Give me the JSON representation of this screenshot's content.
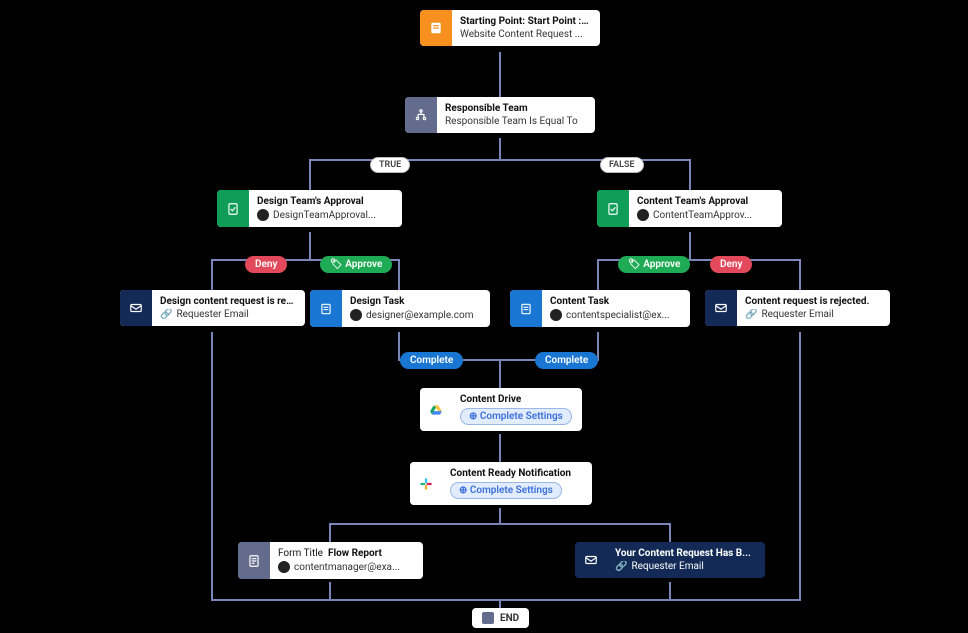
{
  "nodes": {
    "start": {
      "title": "Starting Point: Start Point : C...",
      "sub": "Website Content Request ..."
    },
    "decision": {
      "title": "Responsible Team",
      "sub": "Responsible Team Is Equal To"
    },
    "design_appr": {
      "title": "Design Team's Approval",
      "sub": "DesignTeamApproval..."
    },
    "content_appr": {
      "title": "Content Team's Approval",
      "sub": "ContentTeamApprov..."
    },
    "design_rej": {
      "title": "Design content request is rej...",
      "sub": "Requester Email"
    },
    "design_task": {
      "title": "Design Task",
      "sub": "designer@example.com"
    },
    "content_task": {
      "title": "Content Task",
      "sub": "contentspecialist@ex..."
    },
    "content_rej": {
      "title": "Content request is rejected.",
      "sub": "Requester Email"
    },
    "drive": {
      "title": "Content Drive",
      "settings": "Complete Settings"
    },
    "slack": {
      "title": "Content Ready Notification",
      "settings": "Complete Settings"
    },
    "report": {
      "title_pre": "Form Title",
      "title_b": "Flow Report",
      "sub": "contentmanager@exa..."
    },
    "notify": {
      "title": "Your Content Request Has B...",
      "sub": "Requester Email"
    },
    "end": {
      "label": "END"
    }
  },
  "pills": {
    "true": "TRUE",
    "false": "FALSE",
    "deny": "Deny",
    "approve": "Approve",
    "complete": "Complete"
  }
}
